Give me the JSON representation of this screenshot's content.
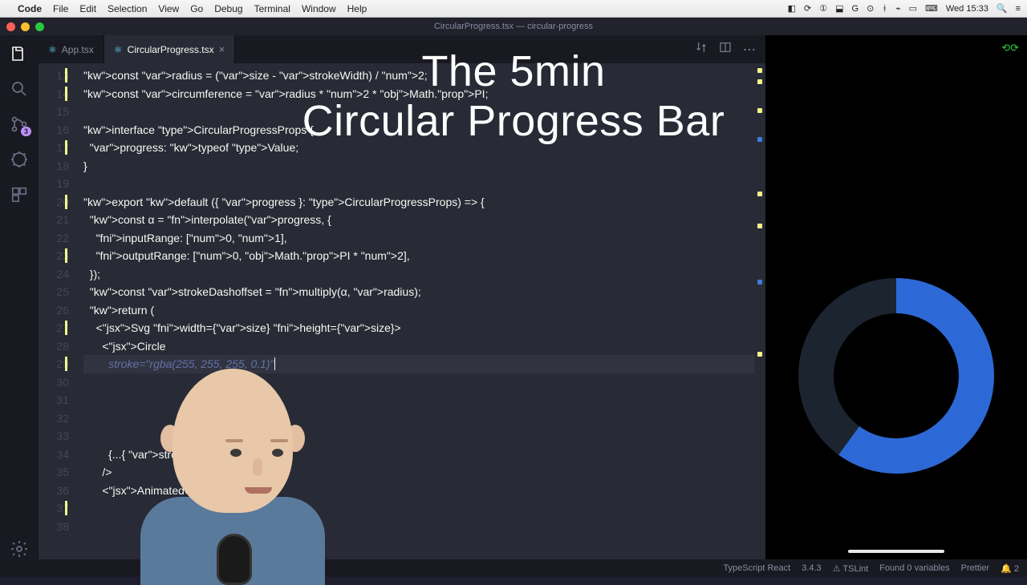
{
  "mac_menu": {
    "app": "Code",
    "items": [
      "File",
      "Edit",
      "Selection",
      "View",
      "Go",
      "Debug",
      "Terminal",
      "Window",
      "Help"
    ],
    "clock": "Wed 15:33"
  },
  "titlebar": {
    "title": "CircularProgress.tsx — circular-progress"
  },
  "tabs": {
    "items": [
      {
        "label": "App.tsx",
        "active": false
      },
      {
        "label": "CircularProgress.tsx",
        "active": true
      }
    ]
  },
  "activity": {
    "scm_badge": "3"
  },
  "overlay": {
    "line1": "The 5min",
    "line2": "Circular Progress Bar"
  },
  "code": {
    "first_line": 13,
    "lines": [
      "const radius = (size - strokeWidth) / 2;",
      "const circumference = radius * 2 * Math.PI;",
      "",
      "interface CircularProgressProps {",
      "  progress: typeof Value;",
      "}",
      "",
      "export default ({ progress }: CircularProgressProps) => {",
      "  const α = interpolate(progress, {",
      "    inputRange: [0, 1],",
      "    outputRange: [0, Math.PI * 2],",
      "  });",
      "  const strokeDashoffset = multiply(α, radius);",
      "  return (",
      "    <Svg width={size} height={size}>",
      "      <Circle",
      "        stroke=\"rgba(255, 255, 255, 0.1)\"",
      "",
      "",
      "",
      "",
      "        {...{ strokeWidth }}",
      "      />",
      "      <AnimatedCircle",
      "",
      ""
    ],
    "modified_lines": [
      13,
      14,
      17,
      20,
      23,
      27,
      29,
      37
    ],
    "active_line": 29
  },
  "status": {
    "lang": "TypeScript React",
    "ts": "3.4.3",
    "tslint": "TSLint",
    "analysis": "Found 0 variables",
    "prettier": "Prettier",
    "notifications": "2"
  },
  "preview": {
    "ring_color": "#2d69d6",
    "ring_bg": "#1c2430",
    "progress": 0.6
  }
}
